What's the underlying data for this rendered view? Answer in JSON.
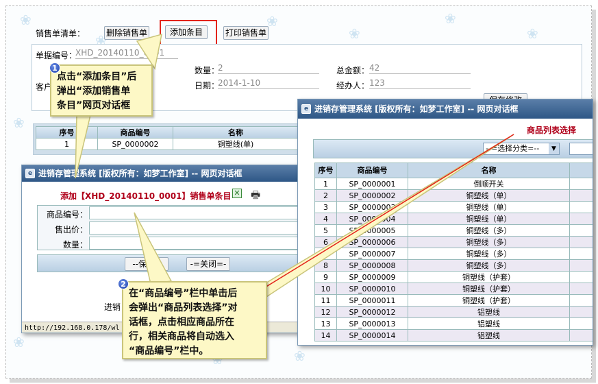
{
  "toolbar": {
    "label": "销售单清单：",
    "delete_btn": "删除销售单",
    "add_btn": "添加条目",
    "print_btn": "打印销售单"
  },
  "form": {
    "doc_no_label": "单据编号：",
    "doc_no_value": "XHD_20140110_0001",
    "customer_label": "客户",
    "qty_label": "数量：",
    "qty_value": "2",
    "date_label": "日期：",
    "date_value": "2014-1-10",
    "total_label": "总金额：",
    "total_value": "42",
    "handler_label": "经办人：",
    "handler_value": "123",
    "save_btn": "保存修改"
  },
  "list_table": {
    "headers": [
      "序号",
      "商品编号",
      "名称"
    ],
    "rows": [
      [
        "1",
        "SP_0000002",
        "铜塑线(单)"
      ]
    ]
  },
  "add_dialog": {
    "title": "进销存管理系统 [版权所有：如梦工作室] -- 网页对话框",
    "heading": "添加【XHD_20140110_0001】销售单条目",
    "field_code": "商品编号：",
    "field_price": "售出价：",
    "field_qty": "数量：",
    "save_btn": "--保存--",
    "close_btn": "-=关闭=-",
    "footer_text": "进销",
    "status_url": "http://192.168.0.178/wl"
  },
  "product_dialog": {
    "title": "进销存管理系统 [版权所有：如梦工作室] -- 网页对话框",
    "heading": "商品列表选择",
    "category_select": "--=选择分类=--",
    "headers": [
      "序号",
      "商品编号",
      "名称"
    ],
    "rows": [
      [
        "1",
        "SP_0000001",
        "倒顺开关"
      ],
      [
        "2",
        "SP_0000002",
        "铜塑线（单）"
      ],
      [
        "3",
        "SP_0000003",
        "铜塑线（单）"
      ],
      [
        "4",
        "SP_0000004",
        "铜塑线（单）"
      ],
      [
        "5",
        "SP_0000005",
        "铜塑线（多）"
      ],
      [
        "6",
        "SP_0000006",
        "铜塑线（多）"
      ],
      [
        "7",
        "SP_0000007",
        "铜塑线（多）"
      ],
      [
        "8",
        "SP_0000008",
        "铜塑线（多）"
      ],
      [
        "9",
        "SP_0000009",
        "铜塑线（护套）"
      ],
      [
        "10",
        "SP_0000010",
        "铜塑线（护套）"
      ],
      [
        "11",
        "SP_0000011",
        "铜塑线（护套）"
      ],
      [
        "12",
        "SP_0000012",
        "铝塑线"
      ],
      [
        "13",
        "SP_0000013",
        "铝塑线"
      ],
      [
        "14",
        "SP_0000014",
        "铝塑线"
      ]
    ]
  },
  "callouts": {
    "one_badge": "1",
    "one_lines": [
      "点击“添加条目”后",
      "弹出“添加销售单",
      "条目”网页对话框"
    ],
    "two_badge": "2",
    "two_lines": [
      "在“商品编号”栏中单击后",
      "会弹出“商品列表选择”对",
      "话框，点击相应商品所在",
      "行，相关商品将自动选入",
      "“商品编号”栏中。"
    ]
  },
  "colors": {
    "accent_red": "#e3241b",
    "title_blue": "#2e5786",
    "heading_red": "#b0001a",
    "callout_bg": "#fdf8c6"
  }
}
